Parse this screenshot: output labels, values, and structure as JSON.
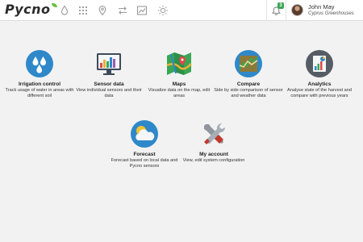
{
  "header": {
    "logo_text": "Pycno",
    "notifications_count": "3",
    "user": {
      "name": "John May",
      "organization": "Cyprus Greenhouses"
    },
    "nav_icons": [
      "water-drop-icon",
      "sensors-grid-icon",
      "map-pin-icon",
      "compare-arrows-icon",
      "chart-icon",
      "sun-icon"
    ]
  },
  "tiles": {
    "irrigation": {
      "title": "Irrigation control",
      "desc": "Track usage of water in areas with different soil",
      "icon": "water-drops-icon"
    },
    "sensor": {
      "title": "Sensor data",
      "desc": "View individual sensors and their data",
      "icon": "sensor-chart-icon"
    },
    "maps": {
      "title": "Maps",
      "desc": "Visualize data on the map, edit areas",
      "icon": "map-icon"
    },
    "compare": {
      "title": "Compare",
      "desc": "Side by side comparison of sensor and weather data",
      "icon": "compare-chart-icon"
    },
    "analytics": {
      "title": "Analytics",
      "desc": "Analyse state of the harvest and compare with previous years",
      "icon": "analytics-icon"
    },
    "forecast": {
      "title": "Forecast",
      "desc": "Forecast based on local data and Pycno sensors",
      "icon": "weather-icon"
    },
    "account": {
      "title": "My account",
      "desc": "View, edit system configuration",
      "icon": "tools-icon"
    }
  },
  "colors": {
    "accent_green": "#3aa655",
    "blue": "#2e88c9",
    "background": "#f2f2f2"
  }
}
